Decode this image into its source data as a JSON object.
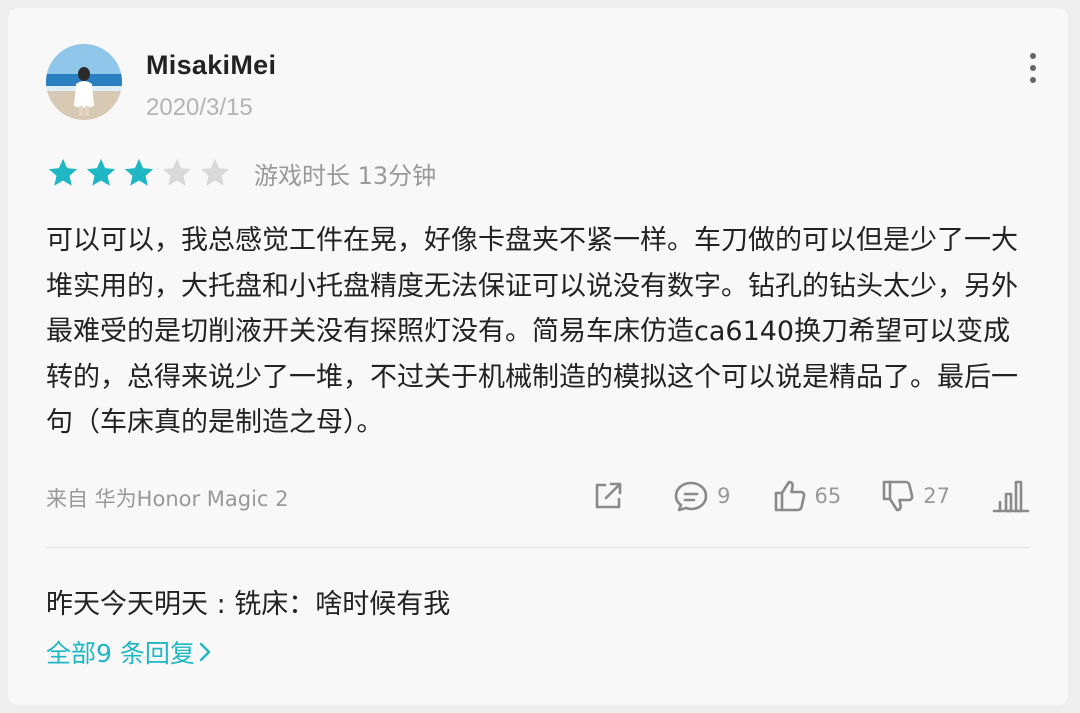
{
  "review": {
    "username": "MisakiMei",
    "date": "2020/3/15",
    "rating": 3,
    "max_rating": 5,
    "playtime": "游戏时长 13分钟",
    "content": "可以可以，我总感觉工件在晃，好像卡盘夹不紧一样。车刀做的可以但是少了一大堆实用的，大托盘和小托盘精度无法保证可以说没有数字。钻孔的钻头太少，另外最难受的是切削液开关没有探照灯没有。简易车床仿造ca6140换刀希望可以变成转的，总得来说少了一堆，不过关于机械制造的模拟这个可以说是精品了。最后一句（车床真的是制造之母）。",
    "device": "来自 华为Honor Magic 2"
  },
  "actions": {
    "comment_count": "9",
    "like_count": "65",
    "dislike_count": "27"
  },
  "reply_preview": {
    "text": "昨天今天明天 : 铣床：啥时候有我",
    "all_replies_label": "全部9 条回复"
  },
  "colors": {
    "accent": "#1fb7c4",
    "star_filled": "#1fb7c4",
    "star_empty": "#d9d9d9",
    "text_primary": "#222222",
    "text_secondary": "#999999"
  },
  "icons": {
    "share": "share-icon",
    "comment": "comment-icon",
    "like": "thumbs-up-icon",
    "dislike": "thumbs-down-icon",
    "stats": "bar-chart-icon",
    "more": "more-vertical-icon"
  }
}
